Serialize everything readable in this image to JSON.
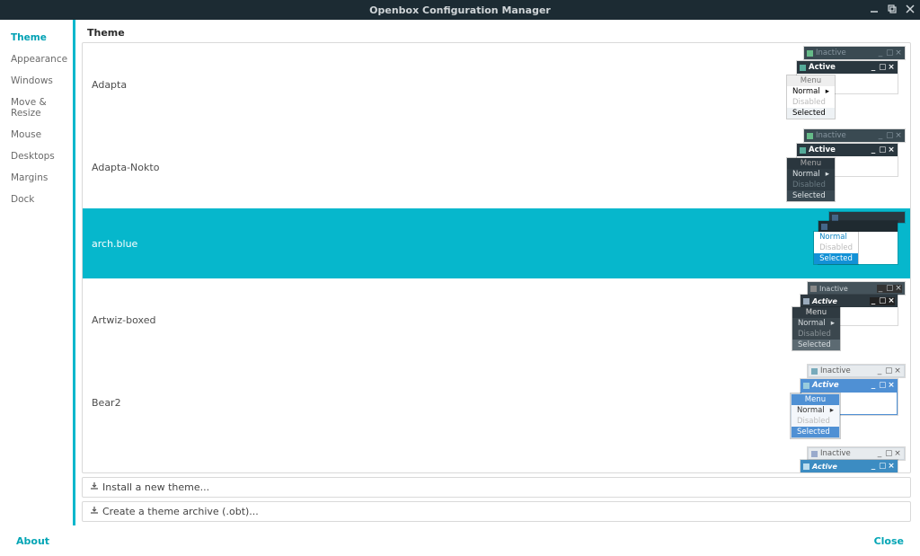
{
  "window": {
    "title": "Openbox Configuration Manager"
  },
  "sidebar": {
    "items": [
      {
        "label": "Theme",
        "active": true
      },
      {
        "label": "Appearance"
      },
      {
        "label": "Windows"
      },
      {
        "label": "Move & Resize"
      },
      {
        "label": "Mouse"
      },
      {
        "label": "Desktops"
      },
      {
        "label": "Margins"
      },
      {
        "label": "Dock"
      }
    ]
  },
  "section_header": "Theme",
  "themes": [
    {
      "name": "Adapta",
      "selected": false,
      "preview": "adapta"
    },
    {
      "name": "Adapta-Nokto",
      "selected": false,
      "preview": "adapta-nokto"
    },
    {
      "name": "arch.blue",
      "selected": true,
      "preview": "arch-blue"
    },
    {
      "name": "Artwiz-boxed",
      "selected": false,
      "preview": "artwiz"
    },
    {
      "name": "Bear2",
      "selected": false,
      "preview": "bear2"
    },
    {
      "name": "",
      "selected": false,
      "preview": "partial"
    }
  ],
  "preview_labels": {
    "inactive": "Inactive",
    "active": "Active",
    "menu": "Menu",
    "normal": "Normal",
    "disabled": "Disabled",
    "selected": "Selected"
  },
  "actions": {
    "install": "Install a new theme...",
    "archive": "Create a theme archive (.obt)..."
  },
  "footer": {
    "about": "About",
    "close": "Close"
  }
}
